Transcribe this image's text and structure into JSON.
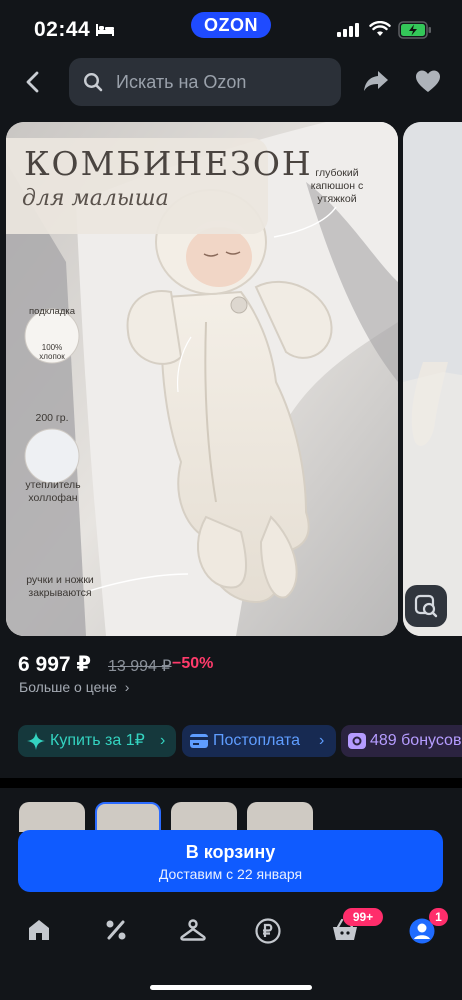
{
  "status": {
    "time": "02:44",
    "brand": "OZON"
  },
  "search": {
    "placeholder": "Искать на Ozon"
  },
  "product_image": {
    "title": "КОМБИНЕЗОН",
    "subtitle": "для малыша",
    "note_hood": "глубокий капюшон с утяжкой",
    "note_lining_label": "подкладка",
    "note_cotton": "100% хлопок",
    "note_weight": "200 гр.",
    "note_insulation": "утеплитель холлофан",
    "note_closing": "ручки и ножки закрываются"
  },
  "price": {
    "current": "6 997 ₽",
    "old": "13 994 ₽",
    "discount": "−50%",
    "more_label": "Больше о цене"
  },
  "chips": [
    {
      "label": "Купить за 1₽",
      "icon": "sparkle-icon"
    },
    {
      "label": "Постоплата",
      "icon": "card-icon"
    },
    {
      "label": "489 бонусов",
      "icon": "bonus-icon"
    }
  ],
  "cart": {
    "label": "В корзину",
    "delivery": "Доставим с 22 января"
  },
  "tabbar": {
    "items": [
      "home-icon",
      "percent-icon",
      "hanger-icon",
      "ruble-icon",
      "basket-icon",
      "profile-icon"
    ],
    "cart_badge": "99+",
    "profile_badge": "1"
  },
  "colors": {
    "accent": "#0f5bff",
    "discount": "#ff3b6b",
    "brand": "#1f4bff"
  }
}
